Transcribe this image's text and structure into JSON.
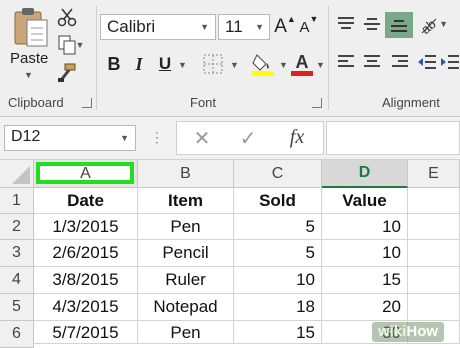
{
  "ribbon": {
    "clipboard": {
      "paste_label": "Paste",
      "group_label": "Clipboard"
    },
    "font": {
      "font_name": "Calibri",
      "font_size": "11",
      "bold_label": "B",
      "italic_label": "I",
      "underline_label": "U",
      "font_color_label": "A",
      "increase_label": "A",
      "decrease_label": "A",
      "group_label": "Font"
    },
    "alignment": {
      "group_label": "Alignment"
    },
    "colors": {
      "fill_yellow": "#ffff00",
      "font_red": "#e02020",
      "active_align": "#7aa88a"
    }
  },
  "formula_bar": {
    "name_box": "D12",
    "fx_label": "fx",
    "cancel_glyph": "✕",
    "enter_glyph": "✓"
  },
  "sheet": {
    "columns": [
      "A",
      "B",
      "C",
      "D",
      "E"
    ],
    "rows": [
      "1",
      "2",
      "3",
      "4",
      "5",
      "6"
    ],
    "header": [
      "Date",
      "Item",
      "Sold",
      "Value"
    ],
    "data": [
      [
        "1/3/2015",
        "Pen",
        "5",
        "10"
      ],
      [
        "2/6/2015",
        "Pencil",
        "5",
        "10"
      ],
      [
        "3/8/2015",
        "Ruler",
        "10",
        "15"
      ],
      [
        "4/3/2015",
        "Notepad",
        "18",
        "20"
      ],
      [
        "5/7/2015",
        "Pen",
        "15",
        "30"
      ]
    ],
    "highlight_color": "#22dd22",
    "active_col_color": "#1e7a3e"
  },
  "watermark": {
    "brand_a": "wiki",
    "brand_b": "How"
  }
}
